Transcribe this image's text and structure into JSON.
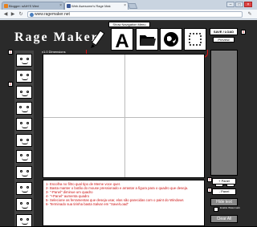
{
  "browser": {
    "tabs": [
      {
        "label": "Blogger: sAtH'S Wed",
        "fav_color": "#e8811c"
      },
      {
        "label": "Web Awesome's Rage Mak",
        "fav_color": "#3b5998"
      }
    ],
    "url": "www.ragemaker.net"
  },
  "app": {
    "logo": "Rage Maker",
    "menu_label": "Show Navigation Menu",
    "save_label": "SAVE / LOAD",
    "preview_label": "Preview",
    "canvas_info": "v1.0   Dimensions",
    "panel_add": "+ Panel",
    "panel_remove": "- Panel",
    "hide_text": "Hide text",
    "watermark": "Enable Watermark",
    "clear_all": "Clear All",
    "badges": {
      "b1": "1",
      "b2": "2",
      "b3": "3",
      "b4": "4",
      "b5": "5",
      "b6": "6"
    },
    "instructions": [
      "1- Escolha no filtro qual tipo de Meme voce quer.",
      "2- Basta manter o botão do mouse pressionado e arrastar a figura para o quadro que deseja.",
      "3- \"-Panel\" diminue um quadro",
      "4- \"+Panel\" aumenta quadro",
      "5- Selecione as ferramentas que deseja usar, elas são parecidas com o paint do Windows",
      "6- Terminado sua tirinha basta Salvar em \"Save/Load\""
    ],
    "accent_color": "#dd1111"
  }
}
